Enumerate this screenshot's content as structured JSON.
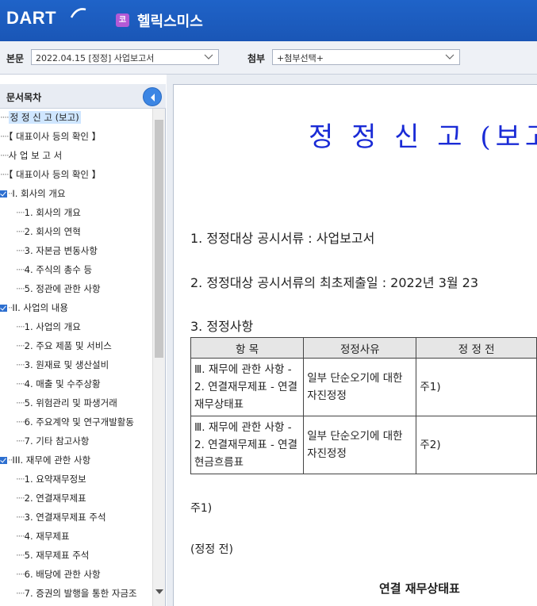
{
  "header": {
    "logo": "DART",
    "corp_badge": "코",
    "corp_name": "헬릭스미스"
  },
  "toolbar": {
    "main_label": "본문",
    "main_value": "2022.04.15 [정정] 사업보고서",
    "attach_label": "첨부",
    "attach_value": "+첨부선택+"
  },
  "sidebar": {
    "title": "문서목차",
    "items": [
      {
        "label": "정 정 신 고 (보고)",
        "level": 0,
        "selected": true
      },
      {
        "label": "【 대표이사 등의 확인 】",
        "level": 0
      },
      {
        "label": "사 업 보 고 서",
        "level": 0
      },
      {
        "label": "【 대표이사 등의 확인 】",
        "level": 0
      },
      {
        "label": "I. 회사의 개요",
        "level": 0,
        "folder": true
      },
      {
        "label": "1. 회사의 개요",
        "level": 1
      },
      {
        "label": "2. 회사의 연혁",
        "level": 1
      },
      {
        "label": "3. 자본금 변동사항",
        "level": 1
      },
      {
        "label": "4. 주식의 총수 등",
        "level": 1
      },
      {
        "label": "5. 정관에 관한 사항",
        "level": 1
      },
      {
        "label": "II. 사업의 내용",
        "level": 0,
        "folder": true
      },
      {
        "label": "1. 사업의 개요",
        "level": 1
      },
      {
        "label": "2. 주요 제품 및 서비스",
        "level": 1
      },
      {
        "label": "3. 원재료 및 생산설비",
        "level": 1
      },
      {
        "label": "4. 매출 및 수주상황",
        "level": 1
      },
      {
        "label": "5. 위험관리 및 파생거래",
        "level": 1
      },
      {
        "label": "6. 주요계약 및 연구개발활동",
        "level": 1
      },
      {
        "label": "7. 기타 참고사항",
        "level": 1
      },
      {
        "label": "III. 재무에 관한 사항",
        "level": 0,
        "folder": true
      },
      {
        "label": "1. 요약재무정보",
        "level": 1
      },
      {
        "label": "2. 연결재무제표",
        "level": 1
      },
      {
        "label": "3. 연결재무제표 주석",
        "level": 1
      },
      {
        "label": "4. 재무제표",
        "level": 1
      },
      {
        "label": "5. 재무제표 주석",
        "level": 1
      },
      {
        "label": "6. 배당에 관한 사항",
        "level": 1
      },
      {
        "label": "7. 증권의 발행을 통한 자금조",
        "level": 1
      }
    ]
  },
  "document": {
    "title": "정 정 신 고 (보고",
    "line1": "1. 정정대상 공시서류 : 사업보고서",
    "line2": "2. 정정대상 공시서류의 최초제출일 : 2022년 3월 23",
    "line3": "3. 정정사항",
    "table_headers": [
      "항  목",
      "정정사유",
      "정 정 전"
    ],
    "table_rows": [
      {
        "item": "Ⅲ. 재무에 관한 사항 - 2. 연결재무제표 - 연결재무상태표",
        "reason": "일부 단순오기에 대한 자진정정",
        "before": "주1)"
      },
      {
        "item": "Ⅲ. 재무에 관한 사항 - 2. 연결재무제표 - 연결현금흐름표",
        "reason": "일부 단순오기에 대한 자진정정",
        "before": "주2)"
      }
    ],
    "note1": "주1)",
    "note2": "(정정 전)",
    "bs_title": "연결 재무상태표"
  },
  "colors": {
    "header_bg": "#1f63c8",
    "title_blue": "#1a2bd6",
    "badge": "#b35ad6"
  }
}
